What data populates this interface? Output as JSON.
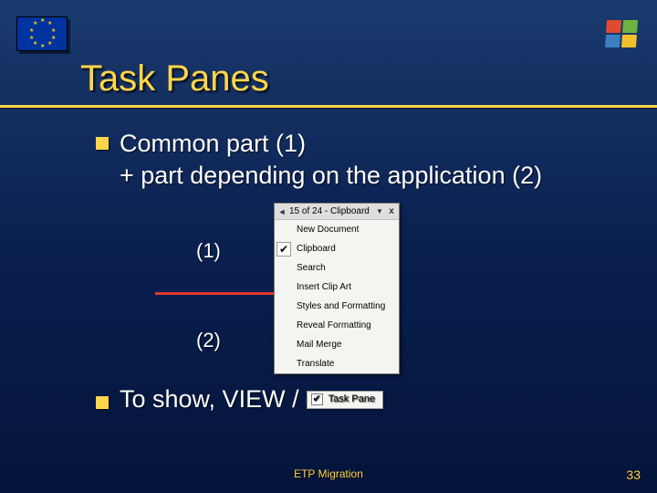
{
  "slide": {
    "title": "Task Panes",
    "bullet1_line1": "Common part (1)",
    "bullet1_line2": "+ part depending on the application (2)",
    "label1": "(1)",
    "label2": "(2)",
    "bullet2_prefix": "To show, VIEW /",
    "footer": "ETP Migration",
    "page": "33"
  },
  "taskpane_menu": {
    "header_arrow": "◄",
    "header_title": "15 of 24 - Clipboard",
    "header_dropdown": "▼",
    "header_close": "x",
    "items": [
      {
        "icon": "",
        "boxed": false,
        "label": "New Document"
      },
      {
        "icon": "✔",
        "boxed": true,
        "label": "Clipboard"
      },
      {
        "icon": "",
        "boxed": false,
        "label": "Search"
      },
      {
        "icon": "",
        "boxed": false,
        "label": "Insert Clip Art"
      },
      {
        "icon": "",
        "boxed": false,
        "label": "Styles and Formatting"
      },
      {
        "icon": "",
        "boxed": false,
        "label": "Reveal Formatting"
      },
      {
        "icon": "",
        "boxed": false,
        "label": "Mail Merge"
      },
      {
        "icon": "",
        "boxed": false,
        "label": "Translate"
      }
    ]
  },
  "taskpane_toggle": {
    "checked_glyph": "✔",
    "label": "Task Pane"
  }
}
